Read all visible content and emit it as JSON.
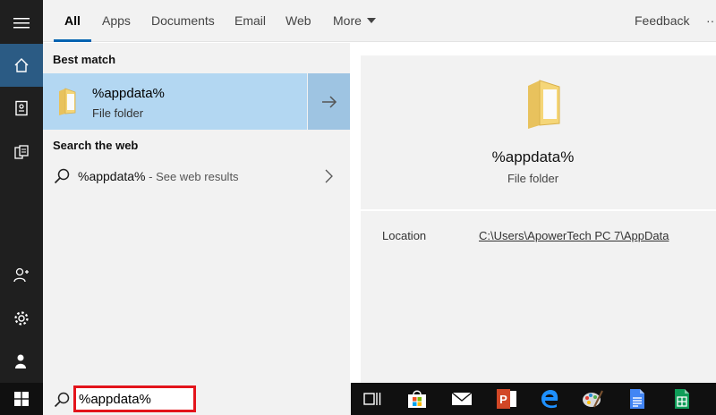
{
  "tabs": {
    "all": "All",
    "apps": "Apps",
    "documents": "Documents",
    "email": "Email",
    "web": "Web",
    "more": "More",
    "feedback": "Feedback",
    "overflow": "···"
  },
  "results": {
    "best_match_header": "Best match",
    "best_match": {
      "title": "%appdata%",
      "subtitle": "File folder"
    },
    "search_web_header": "Search the web",
    "web_result": {
      "query": "%appdata%",
      "hint": " - See web results"
    }
  },
  "preview": {
    "title": "%appdata%",
    "subtitle": "File folder",
    "location_label": "Location",
    "location_value": "C:\\Users\\ApowerTech PC 7\\AppData"
  },
  "search": {
    "value": "%appdata%"
  },
  "sidebar": {
    "items": [
      {
        "icon": "hamburger-icon"
      },
      {
        "icon": "home-icon",
        "active": true
      },
      {
        "icon": "notebook-icon"
      },
      {
        "icon": "documents-icon"
      },
      {
        "icon": "add-user-icon"
      },
      {
        "icon": "gear-icon"
      },
      {
        "icon": "feedback-person-icon"
      }
    ]
  },
  "taskbar": {
    "icons": [
      "task-view-icon",
      "store-icon",
      "mail-icon",
      "powerpoint-icon",
      "edge-icon",
      "paint-icon",
      "docs-icon",
      "sheets-icon"
    ]
  },
  "colors": {
    "accent": "#0063b1",
    "selection": "#b3d7f2",
    "highlight_border": "#e3141b"
  }
}
